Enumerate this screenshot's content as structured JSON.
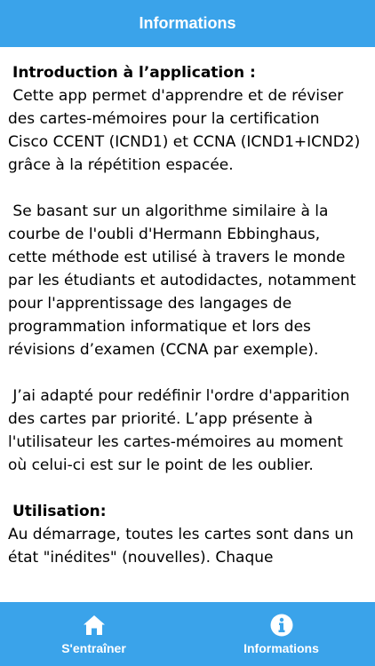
{
  "header": {
    "title": "Informations"
  },
  "content": {
    "intro_heading": "Introduction à l’application :",
    "intro_paragraphs": [
      " Cette app permet d'apprendre et de réviser des cartes-mémoires pour la certification Cisco CCENT (ICND1) et CCNA (ICND1+ICND2) grâce à la répétition espacée.",
      " Se basant sur un algorithme similaire à la courbe de l'oubli d'Hermann Ebbinghaus, cette méthode est utilisé à travers le monde par les étudiants et autodidactes, notamment pour l'apprentissage des langages de programmation informatique et lors des révisions d’examen (CCNA par exemple).",
      " J’ai adapté pour redéfinir l'ordre d'apparition des cartes par priorité. L’app présente à l'utilisateur les cartes-mémoires au moment où celui-ci est sur le point de les oublier."
    ],
    "usage_heading": "Utilisation:",
    "usage_paragraphs": [
      "Au démarrage, toutes les cartes sont dans un état \"inédites\" (nouvelles). Chaque"
    ]
  },
  "tabbar": {
    "tabs": [
      {
        "label": "S'entraîner",
        "icon": "home-icon"
      },
      {
        "label": "Informations",
        "icon": "info-icon"
      }
    ]
  },
  "colors": {
    "accent": "#3aa3ea",
    "text": "#000000",
    "bar_text": "#ffffff"
  }
}
